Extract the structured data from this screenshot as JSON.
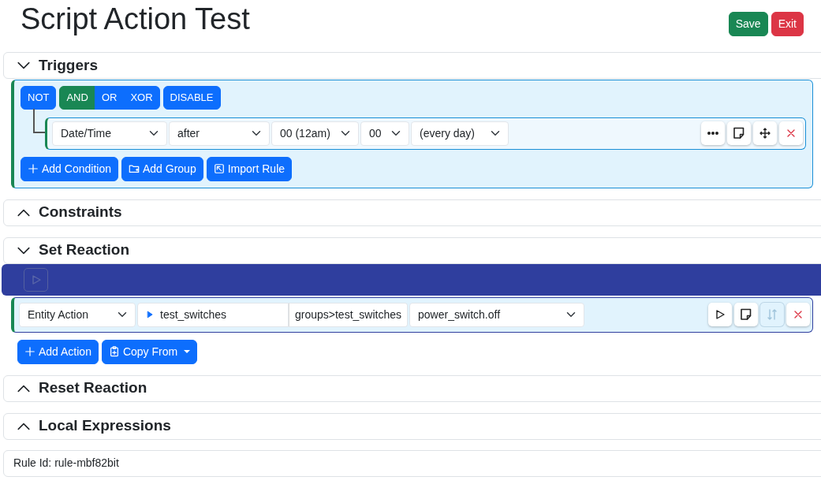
{
  "title": "Script Action Test",
  "header_buttons": [
    {
      "label": "Save",
      "kind": "save"
    },
    {
      "label": "Exit",
      "kind": "exit"
    }
  ],
  "sections": [
    {
      "title": "Triggers",
      "expanded": true,
      "kind": "triggers",
      "content": {
        "not_button": "NOT",
        "operators": [
          {
            "label": "AND",
            "selected": true
          },
          {
            "label": "OR",
            "selected": false
          },
          {
            "label": "XOR",
            "selected": false
          }
        ],
        "disable_button": "DISABLE",
        "conditions": [
          {
            "selects": [
              "Date/Time",
              "after",
              "00 (12am)",
              "00",
              "(every day)"
            ],
            "tools": [
              {
                "kind": "more",
                "disabled": false
              },
              {
                "kind": "note",
                "disabled": false
              },
              {
                "kind": "move",
                "disabled": false
              },
              {
                "kind": "delete",
                "disabled": false
              }
            ]
          }
        ],
        "buttons": [
          {
            "label": "Add Condition",
            "kind": "plus"
          },
          {
            "label": "Add Group",
            "kind": "group"
          },
          {
            "label": "Import Rule",
            "kind": "import"
          }
        ]
      }
    },
    {
      "title": "Constraints",
      "expanded": false
    },
    {
      "title": "Set Reaction",
      "expanded": true,
      "kind": "actions",
      "content": {
        "run_bar": {
          "disabled": true
        },
        "actions": [
          {
            "type_select": "Entity Action",
            "entity": "test_switches",
            "entity_path": "groups>test_switches",
            "service_select": "power_switch.off",
            "tools": [
              {
                "kind": "run",
                "disabled": false
              },
              {
                "kind": "note",
                "disabled": false
              },
              {
                "kind": "swap",
                "disabled": true
              },
              {
                "kind": "delete",
                "disabled": false
              }
            ]
          }
        ],
        "buttons": [
          {
            "label": "Add Action",
            "kind": "plus",
            "dropdown": false
          },
          {
            "label": "Copy From",
            "kind": "clipboard",
            "dropdown": true
          }
        ]
      }
    },
    {
      "title": "Reset Reaction",
      "expanded": false
    },
    {
      "title": "Local Expressions",
      "expanded": false
    }
  ],
  "footer": {
    "rule_id": "Rule Id: rule-mbf82bit"
  }
}
